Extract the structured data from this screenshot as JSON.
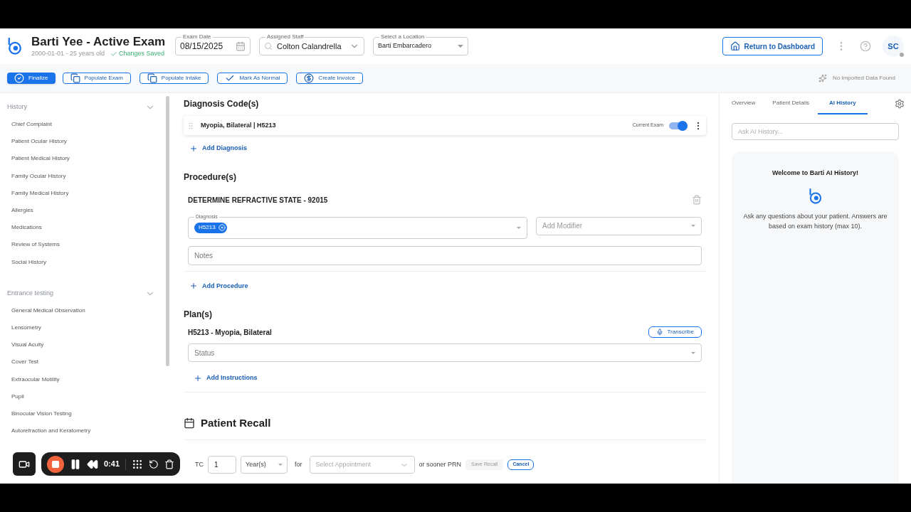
{
  "header": {
    "title": "Barti Yee - Active Exam",
    "subtitle": "2000-01-01 - 25 years old",
    "save_status": "Changes Saved",
    "exam_date": {
      "label": "Exam Date",
      "value": "08/15/2025"
    },
    "assigned_staff": {
      "label": "Assigned Staff",
      "value": "Colton Calandrella"
    },
    "location": {
      "label": "Select a Location",
      "value": "Barti Embarcadero"
    },
    "return_button": "Return to Dashboard",
    "avatar": "SC"
  },
  "toolbar": {
    "buttons": [
      {
        "label": "Finalize",
        "kind": "primary"
      },
      {
        "label": "Populate Exam",
        "kind": "outline"
      },
      {
        "label": "Populate Intake",
        "kind": "outline"
      },
      {
        "label": "Mark As Normal",
        "kind": "outline"
      },
      {
        "label": "Create Invoice",
        "kind": "outline"
      }
    ],
    "import_status": "No Imported Data Found"
  },
  "sidebar": {
    "sections": [
      {
        "title": "History",
        "expanded": true,
        "items": [
          "Chief Complaint",
          "Patient Ocular History",
          "Patient Medical History",
          "Family Ocular History",
          "Family Medical History",
          "Allergies",
          "Medications",
          "Review of Systems",
          "Social History"
        ]
      },
      {
        "title": "Entrance testing",
        "expanded": true,
        "items": [
          "General Medical Observation",
          "Lensometry",
          "Visual Acuity",
          "Cover Test",
          "Extraocular Motility",
          "Pupil",
          "Binocular Vision Testing",
          "Autorefraction and Keratometry"
        ]
      }
    ]
  },
  "diagnosis": {
    "heading": "Diagnosis Code(s)",
    "items": [
      {
        "label": "Myopia, Bilateral | H5213",
        "toggle_label": "Current Exam",
        "on": true
      }
    ],
    "add": "Add Diagnosis"
  },
  "procedures": {
    "heading": "Procedure(s)",
    "items": [
      {
        "title": "DETERMINE REFRACTIVE STATE - 92015",
        "diagnosis_label": "Diagnosis",
        "chips": [
          "H5213"
        ],
        "modifier_placeholder": "Add Modifier",
        "notes_placeholder": "Notes"
      }
    ],
    "add": "Add Procedure"
  },
  "plans": {
    "heading": "Plan(s)",
    "items": [
      {
        "title": "H5213 - Myopia, Bilateral",
        "transcribe": "Transcribe",
        "status_placeholder": "Status",
        "add": "Add Instructions"
      }
    ]
  },
  "recall": {
    "heading": "Patient Recall",
    "prefix": "TC",
    "count": "1",
    "unit": "Year(s)",
    "for": "for",
    "appointment_placeholder": "Select Appointment",
    "suffix": "or sooner PRN",
    "save": "Save Recall",
    "cancel": "Cancel"
  },
  "right_panel": {
    "tabs": [
      {
        "label": "Overview",
        "selected": false
      },
      {
        "label": "Patient Details",
        "selected": false
      },
      {
        "label": "AI History",
        "selected": true
      }
    ],
    "search_placeholder": "Ask AI History...",
    "welcome_title": "Welcome to Barti AI History!",
    "welcome_text": "Ask any questions about your patient. Answers are based on exam history (max 10)."
  },
  "recorder": {
    "time": "0:41"
  }
}
